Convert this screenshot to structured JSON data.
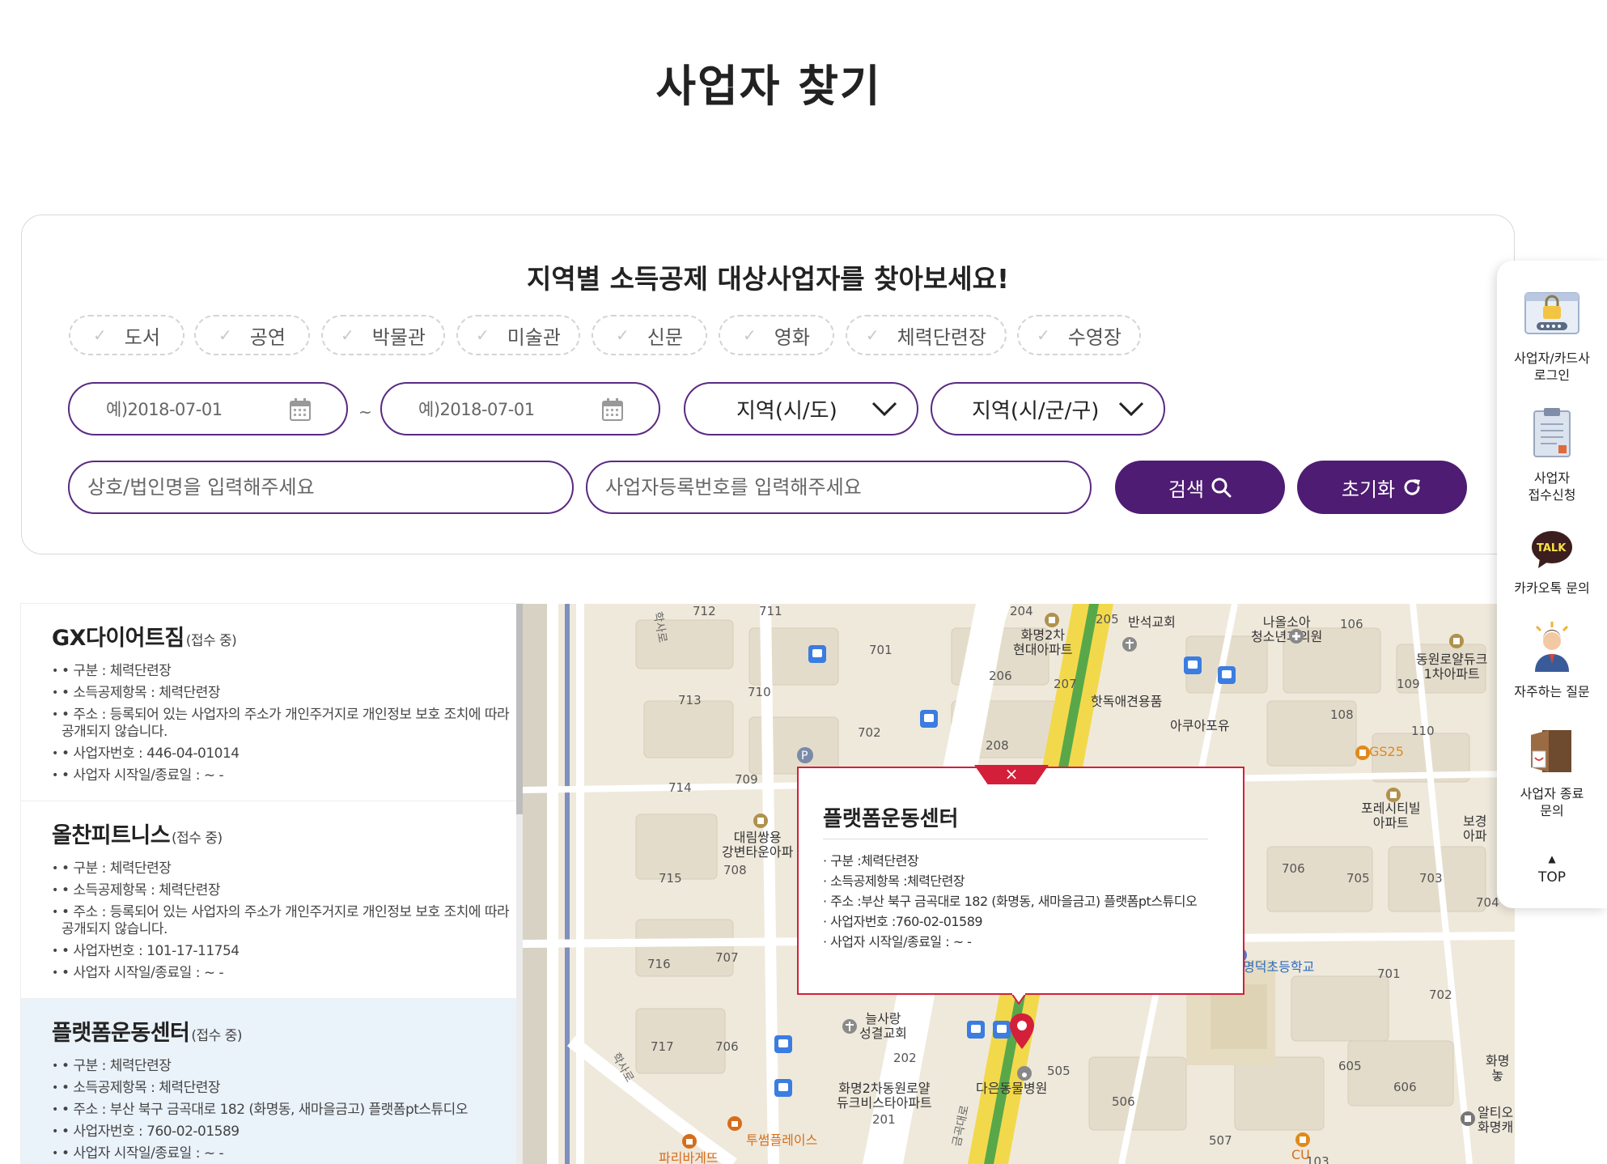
{
  "page": {
    "title": "사업자 찾기"
  },
  "search": {
    "heading": "지역별 소득공제 대상사업자를 찾아보세요!",
    "categories": [
      "도서",
      "공연",
      "박물관",
      "미술관",
      "신문",
      "영화",
      "체력단련장",
      "수영장"
    ],
    "date_start_placeholder": "예)2018-07-01",
    "date_separator": "~",
    "date_end_placeholder": "예)2018-07-01",
    "region_sido": "지역(시/도)",
    "region_sigungu": "지역(시/군/구)",
    "name_placeholder": "상호/법인명을 입력해주세요",
    "regno_placeholder": "사업자등록번호를 입력해주세요",
    "search_label": "검색",
    "reset_label": "초기화"
  },
  "results": [
    {
      "name": "GX다이어트짐",
      "status": "(접수 중)",
      "category": "• 구분 : 체력단련장",
      "deduction": "• 소득공제항목 : 체력단련장",
      "address": "• 주소 : 등록되어 있는 사업자의 주소가 개인주거지로 개인정보 보호 조치에 따라 공개되지 않습니다.",
      "regno": "• 사업자번호 : 446-04-01014",
      "period": "• 사업자 시작일/종료일 : ~ -"
    },
    {
      "name": "올찬피트니스",
      "status": "(접수 중)",
      "category": "• 구분 : 체력단련장",
      "deduction": "• 소득공제항목 : 체력단련장",
      "address": "• 주소 : 등록되어 있는 사업자의 주소가 개인주거지로 개인정보 보호 조치에 따라 공개되지 않습니다.",
      "regno": "• 사업자번호 : 101-17-11754",
      "period": "• 사업자 시작일/종료일 : ~ -"
    },
    {
      "name": "플랫폼운동센터",
      "status": "(접수 중)",
      "category": "• 구분 : 체력단련장",
      "deduction": "• 소득공제항목 : 체력단련장",
      "address": "• 주소 : 부산 북구 금곡대로 182 (화명동, 새마을금고) 플랫폼pt스튜디오",
      "regno": "• 사업자번호 : 760-02-01589",
      "period": "• 사업자 시작일/종료일 : ~ -"
    }
  ],
  "popup": {
    "title": "플랫폼운동센터",
    "close": "×",
    "category": "· 구분 :체력단련장",
    "deduction": "· 소득공제항목 :체력단련장",
    "address": "· 주소 :부산 북구 금곡대로 182 (화명동, 새마을금고) 플랫폼pt스튜디오",
    "regno": "· 사업자번호 :760-02-01589",
    "period": "· 사업자 시작일/종료일 : ~ -"
  },
  "map": {
    "labels": {
      "hwamyeong2": "화명2차\n현대아파트",
      "banseok_church": "반석교회",
      "naulsoa": "나올소아\n청소년과의원",
      "dongwon": "동원로얄듀크\n1차아파트",
      "hotdog": "핫독애견용품",
      "aqua": "아쿠아포유",
      "gs25": "GS25",
      "porest": "포레시티빌\n아파트",
      "borim": "보경\n아파",
      "daerim": "대림쌍용\n강변타운아파",
      "myeongdeok": "명덕초등학교",
      "neulsarang": "늘사랑\n성결교회",
      "dongwon2": "화명2차동원로얄\n듀크비스타아파트",
      "daun": "다은동물병원",
      "twosome": "투썸플레이스",
      "paris": "파리바게뜨",
      "cu": "CU",
      "alte": "알티오\n화명캐",
      "hwamyeong_right": "화명\n놓",
      "road_haksa": "학사로",
      "road_geumgok": "금곡대로"
    },
    "numbers": [
      "712",
      "711",
      "204",
      "205",
      "106",
      "701",
      "206",
      "207",
      "109",
      "713",
      "710",
      "702",
      "208",
      "108",
      "110",
      "714",
      "709",
      "708",
      "715",
      "706",
      "705",
      "703",
      "704",
      "716",
      "707",
      "701",
      "702",
      "717",
      "706",
      "202",
      "505",
      "605",
      "606",
      "201",
      "506",
      "507",
      "103"
    ]
  },
  "quick_menu": {
    "items": [
      {
        "label": "사업자/카드사\n로그인",
        "icon": "lock-icon"
      },
      {
        "label": "사업자\n접수신청",
        "icon": "clipboard-icon"
      },
      {
        "label": "카카오톡 문의",
        "icon": "kakaotalk-icon",
        "badge": "TALK"
      },
      {
        "label": "자주하는 질문",
        "icon": "faq-person-icon"
      },
      {
        "label": "사업자 종료\n문의",
        "icon": "door-exit-icon"
      }
    ],
    "top_arrow": "▲",
    "top_label": "TOP"
  },
  "colors": {
    "brand": "#4e1c72",
    "popup_accent": "#d41f3a",
    "map_base": "#efe9dc"
  }
}
